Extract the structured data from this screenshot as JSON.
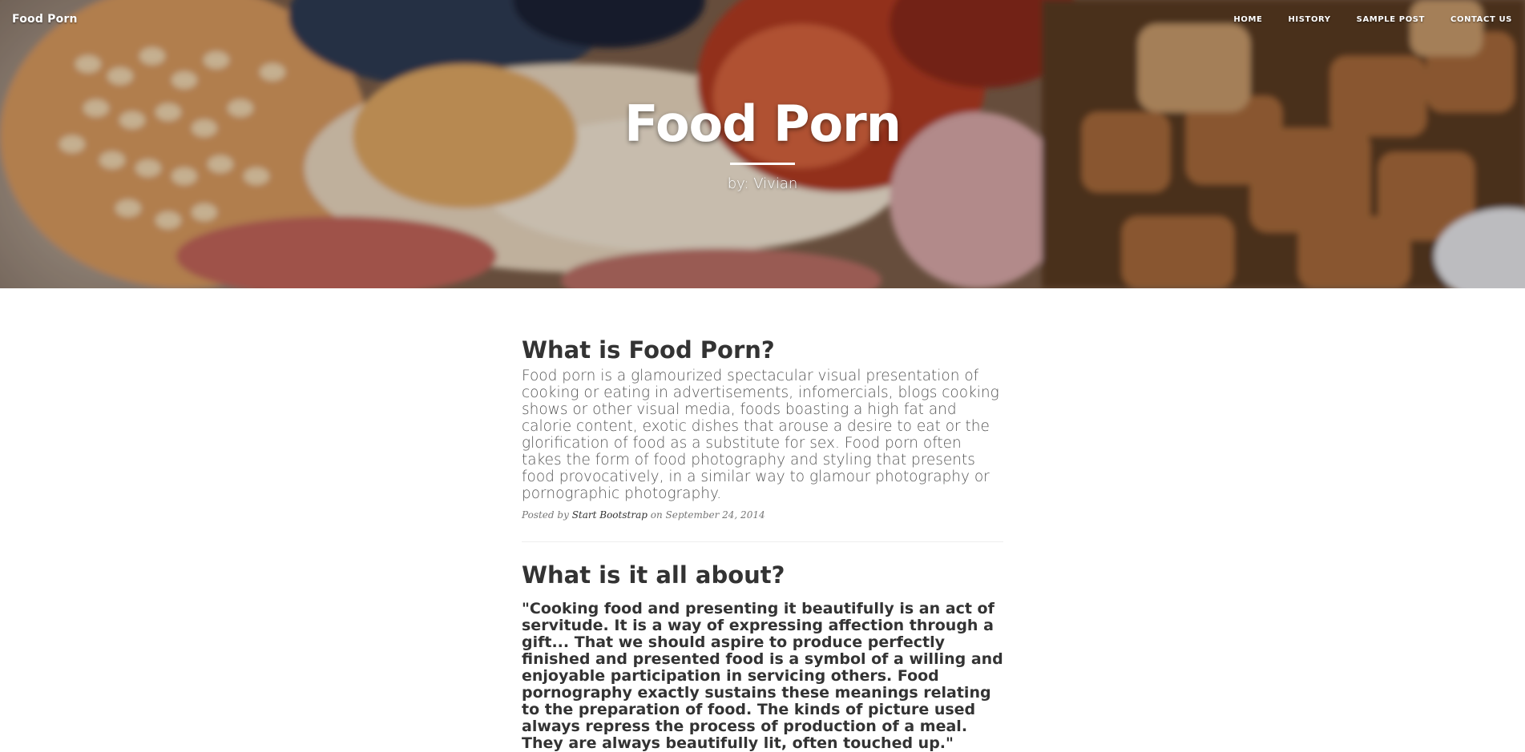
{
  "brand": "Food Porn",
  "nav": {
    "items": [
      {
        "label": "HOME"
      },
      {
        "label": "HISTORY"
      },
      {
        "label": "SAMPLE POST"
      },
      {
        "label": "CONTACT US"
      }
    ]
  },
  "hero": {
    "title": "Food Porn",
    "subtitle": "by: Vivian"
  },
  "posts": [
    {
      "title": "What is Food Porn?",
      "body": "Food porn is a glamourized spectacular visual presentation of cooking or eating in advertisements, infomercials, blogs cooking shows or other visual media, foods boasting a high fat and calorie content, exotic dishes that arouse a desire to eat or the glorification of food as a substitute for sex. Food porn often takes the form of food photography and styling that presents food provocatively, in a similar way to glamour photography or pornographic photography.",
      "meta_prefix": "Posted by",
      "author": "Start Bootstrap",
      "meta_on": "on",
      "date": "September 24, 2014"
    },
    {
      "title": "What is it all about?",
      "quote": "\"Cooking food and presenting it beautifully is an act of servitude. It is a way of expressing affection through a gift... That we should aspire to produce perfectly finished and presented food is a symbol of a willing and enjoyable participation in servicing others. Food pornography exactly sustains these meanings relating to the preparation of food. The kinds of picture used always repress the process of production of a meal. They are always beautifully lit, often touched up.\""
    }
  ]
}
